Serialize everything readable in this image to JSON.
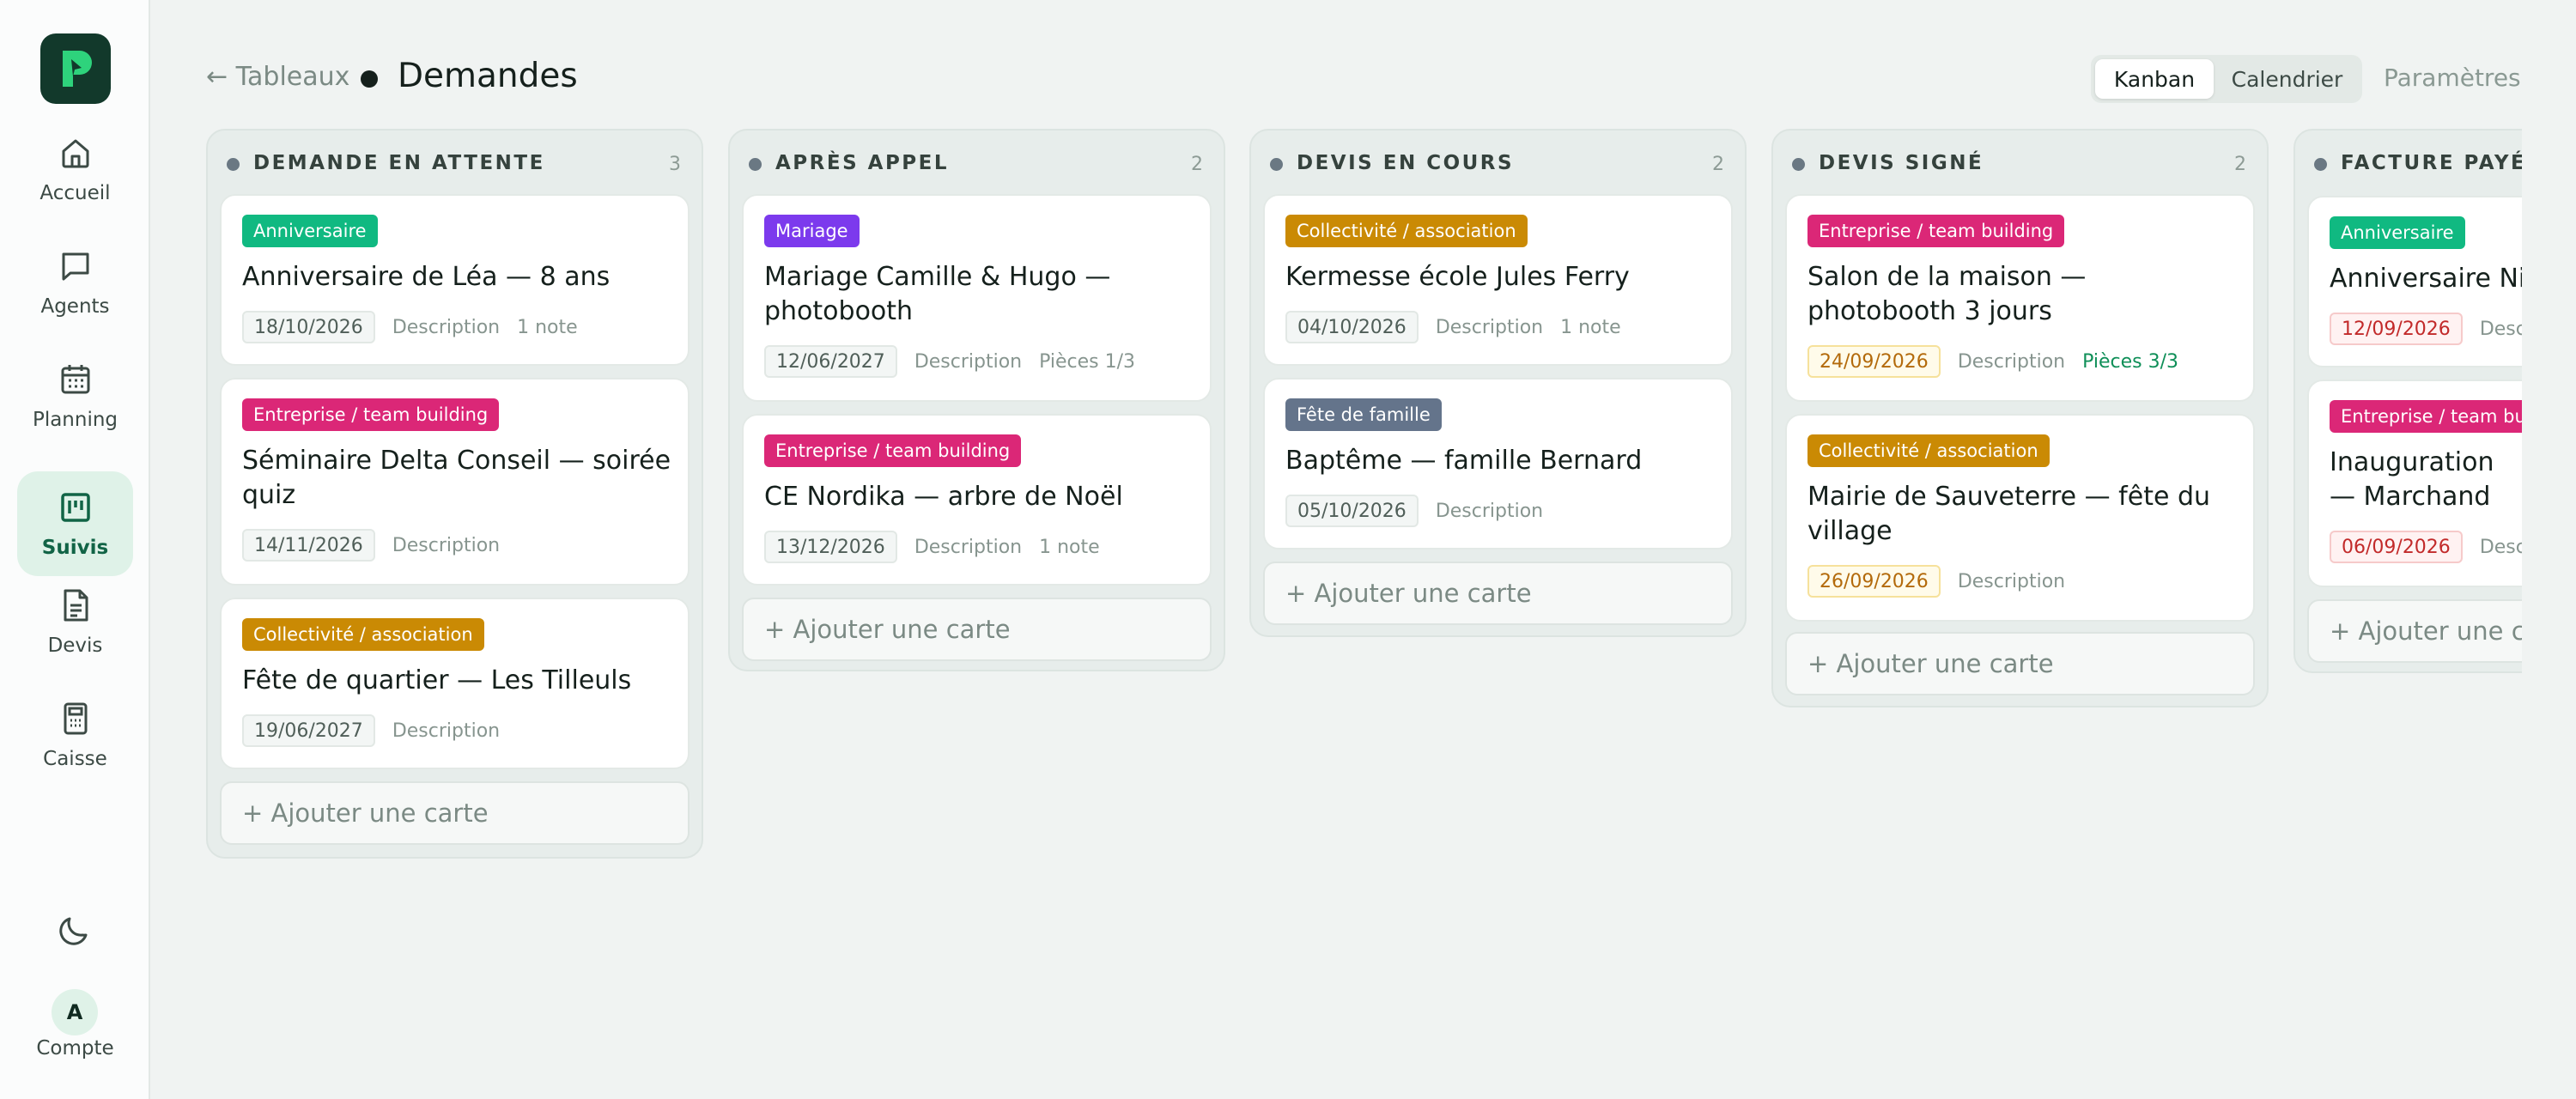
{
  "sidebar": {
    "items": [
      {
        "label": "Accueil",
        "icon": "home-icon"
      },
      {
        "label": "Agents",
        "icon": "chat-icon"
      },
      {
        "label": "Planning",
        "icon": "calendar-icon"
      },
      {
        "label": "Suivis",
        "icon": "kanban-icon",
        "active": true
      },
      {
        "label": "Devis",
        "icon": "document-icon"
      },
      {
        "label": "Caisse",
        "icon": "calculator-icon"
      }
    ],
    "theme_icon": "moon-icon",
    "account": {
      "initial": "A",
      "label": "Compte"
    }
  },
  "header": {
    "back_label": "← Tableaux",
    "title": "Demandes",
    "views": [
      "Kanban",
      "Calendrier"
    ],
    "active_view": "Kanban",
    "settings_label": "Paramètres"
  },
  "board": {
    "add_card_label": "+ Ajouter une carte",
    "columns": [
      {
        "title": "DEMANDE EN ATTENTE",
        "count": "3",
        "cards": [
          {
            "tag": "Anniversaire",
            "title": "Anniversaire de Léa — 8 ans",
            "date": "18/10/2026",
            "description": "Description",
            "extra": "1 note"
          },
          {
            "tag": "Entreprise / team building",
            "title": "Séminaire Delta Conseil — soirée quiz",
            "date": "14/11/2026",
            "description": "Description",
            "extra": ""
          },
          {
            "tag": "Collectivité / association",
            "title": "Fête de quartier — Les Tilleuls",
            "date": "19/06/2027",
            "description": "Description",
            "extra": ""
          }
        ]
      },
      {
        "title": "APRÈS APPEL",
        "count": "2",
        "cards": [
          {
            "tag": "Mariage",
            "title": "Mariage Camille & Hugo — photobooth",
            "date": "12/06/2027",
            "description": "Description",
            "extra": "Pièces 1/3"
          },
          {
            "tag": "Entreprise / team building",
            "title": "CE Nordika — arbre de Noël",
            "date": "13/12/2026",
            "description": "Description",
            "extra": "1 note"
          }
        ]
      },
      {
        "title": "DEVIS EN COURS",
        "count": "2",
        "cards": [
          {
            "tag": "Collectivité / association",
            "title": "Kermesse école Jules Ferry",
            "date": "04/10/2026",
            "description": "Description",
            "extra": "1 note"
          },
          {
            "tag": "Fête de famille",
            "title": "Baptême — famille Bernard",
            "date": "05/10/2026",
            "description": "Description",
            "extra": ""
          }
        ]
      },
      {
        "title": "DEVIS SIGNÉ",
        "count": "2",
        "cards": [
          {
            "tag": "Entreprise / team building",
            "title": "Salon de la maison — photobooth 3 jours",
            "date": "24/09/2026",
            "description": "Description",
            "extra": "Pièces 3/3"
          },
          {
            "tag": "Collectivité / association",
            "title": "Mairie de Sauveterre — fête du village",
            "date": "26/09/2026",
            "description": "Description",
            "extra": ""
          }
        ]
      },
      {
        "title": "FACTURE PAYÉE",
        "count": "",
        "cards": [
          {
            "tag": "Anniversaire",
            "title": "Anniversaire Nin",
            "date": "12/09/2026",
            "description": "Desc",
            "extra": ""
          },
          {
            "tag": "Entreprise / team bui",
            "title": "Inauguration — Marchand",
            "date": "06/09/2026",
            "description": "Desc",
            "extra": ""
          }
        ]
      }
    ]
  },
  "colors": {
    "brand": "#12392b",
    "accent": "#116446",
    "tag_anniversaire": "#10b981",
    "tag_entreprise": "#db2777",
    "tag_collectivite": "#ca8a04",
    "tag_mariage": "#7c3aed",
    "tag_famille": "#64748b",
    "date_warning": "#b36a0b",
    "date_overdue": "#c22a2a",
    "complete": "#0f8f58"
  }
}
